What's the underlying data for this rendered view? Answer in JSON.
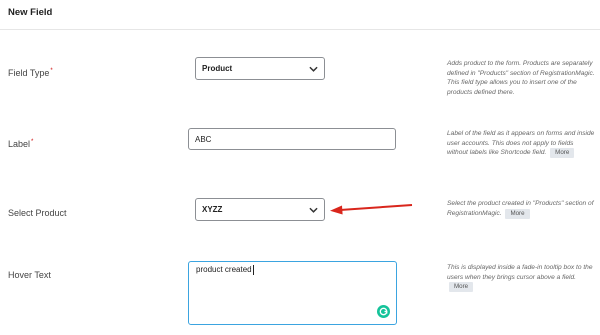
{
  "header": {
    "title": "New Field"
  },
  "fields": {
    "field_type": {
      "label": "Field Type",
      "required_mark": "*",
      "value": "Product",
      "help": "Adds product to the form. Products are separately defined in \"Products\" section of RegistrationMagic. This field type allows you to insert one of the products defined there."
    },
    "label": {
      "label": "Label",
      "required_mark": "*",
      "value": "ABC",
      "help": "Label of the field as it appears on forms and inside user accounts. This does not apply to fields without labels like Shortcode field.",
      "more": "More"
    },
    "select_product": {
      "label": "Select Product",
      "value": "XYZZ",
      "help": "Select the product created in \"Products\" section of RegistrationMagic.",
      "more": "More"
    },
    "hover_text": {
      "label": "Hover Text",
      "value": "product created",
      "help": "This is displayed inside a fade-in tooltip box to the users when they brings cursor above a field.",
      "more": "More"
    }
  },
  "colors": {
    "annotation_arrow": "#d9261c",
    "focus_border": "#3ba4e0",
    "grammarly": "#15c39a"
  },
  "icons": {
    "dropdown": "chevron-down-icon",
    "annotation": "red-arrow-icon",
    "grammarly": "grammarly-icon"
  }
}
